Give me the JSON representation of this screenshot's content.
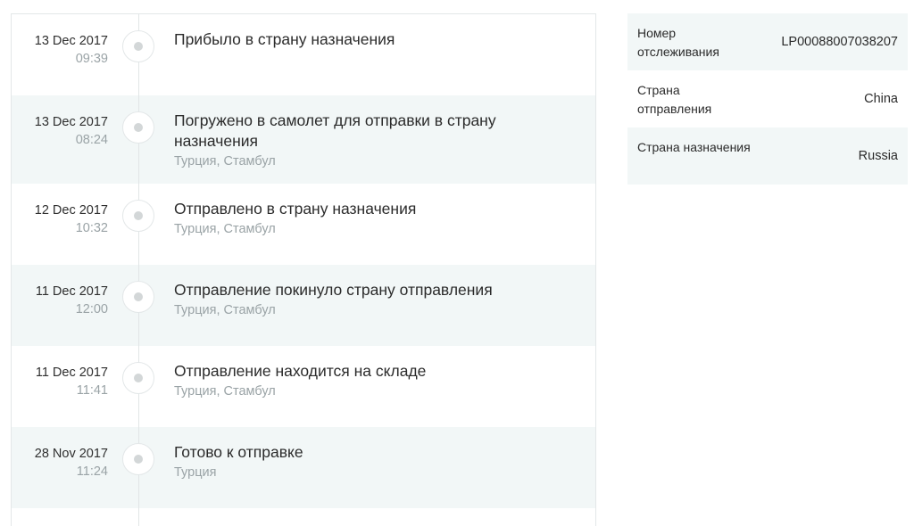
{
  "timeline": {
    "events": [
      {
        "date": "13 Dec 2017",
        "time": "09:39",
        "title": "Прибыло в страну назначения",
        "location": ""
      },
      {
        "date": "13 Dec 2017",
        "time": "08:24",
        "title": "Погружено в самолет для отправки в страну назначения",
        "location": "Турция, Стамбул"
      },
      {
        "date": "12 Dec 2017",
        "time": "10:32",
        "title": "Отправлено в страну назначения",
        "location": "Турция, Стамбул"
      },
      {
        "date": "11 Dec 2017",
        "time": "12:00",
        "title": "Отправление покинуло страну отправления",
        "location": "Турция, Стамбул"
      },
      {
        "date": "11 Dec 2017",
        "time": "11:41",
        "title": "Отправление находится на складе",
        "location": "Турция, Стамбул"
      },
      {
        "date": "28 Nov 2017",
        "time": "11:24",
        "title": "Готово к отправке",
        "location": "Турция"
      }
    ]
  },
  "info": {
    "rows": [
      {
        "label": "Номер отслеживания",
        "value": "LP00088007038207"
      },
      {
        "label": "Страна отправления",
        "value": "China"
      },
      {
        "label": "Страна назначения",
        "value": "Russia"
      }
    ]
  }
}
